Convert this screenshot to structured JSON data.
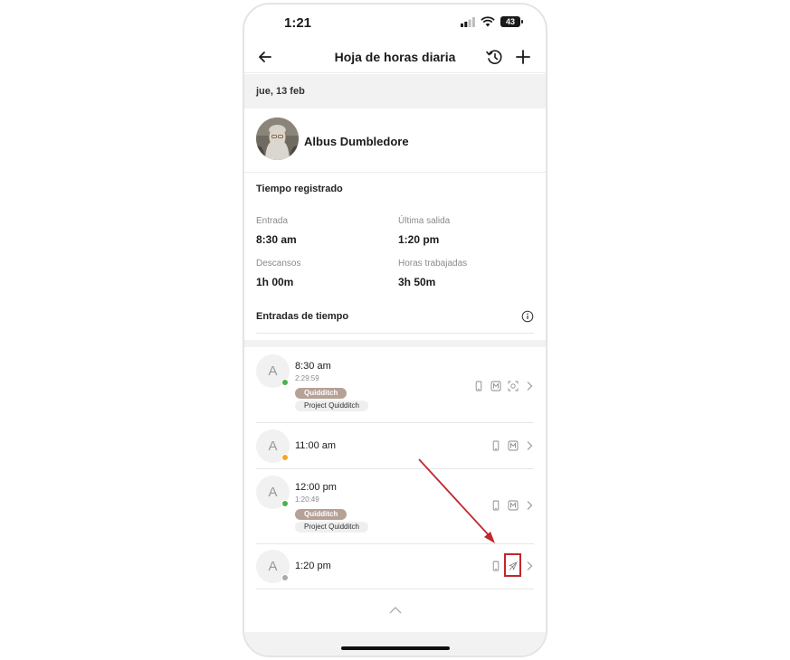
{
  "status_bar": {
    "time": "1:21",
    "battery": "43"
  },
  "nav": {
    "title": "Hoja de horas diaria"
  },
  "date": "jue, 13 feb",
  "user": {
    "name": "Albus Dumbledore"
  },
  "time_registered": {
    "title": "Tiempo registrado",
    "stats": [
      {
        "label": "Entrada",
        "value": "8:30 am"
      },
      {
        "label": "Última salida",
        "value": "1:20 pm"
      },
      {
        "label": "Descansos",
        "value": "1h 00m"
      },
      {
        "label": "Horas trabajadas",
        "value": "3h 50m"
      }
    ]
  },
  "entries_section": {
    "title": "Entradas de tiempo"
  },
  "entries": [
    {
      "initial": "A",
      "time": "8:30 am",
      "duration": "2:29:59",
      "activity": "Quidditch",
      "project": "Project Quidditch",
      "status_color": "#4caf50"
    },
    {
      "initial": "A",
      "time": "11:00 am",
      "status_color": "#f5a623"
    },
    {
      "initial": "A",
      "time": "12:00 pm",
      "duration": "1:20:49",
      "activity": "Quidditch",
      "project": "Project Quidditch",
      "status_color": "#4caf50"
    },
    {
      "initial": "A",
      "time": "1:20 pm",
      "status_color": "#aaaaaa"
    }
  ],
  "icons": {
    "back": "arrow-left-icon",
    "history": "history-icon",
    "add": "plus-icon",
    "info": "info-icon",
    "device": "mobile-device-icon",
    "manual": "manual-entry-icon",
    "face": "face-scan-icon",
    "no_location": "location-off-icon",
    "chevron": "chevron-right-icon",
    "collapse": "chevron-up-icon"
  },
  "colors": {
    "highlight": "#c0272d",
    "activity_tag": "#b6a197"
  }
}
